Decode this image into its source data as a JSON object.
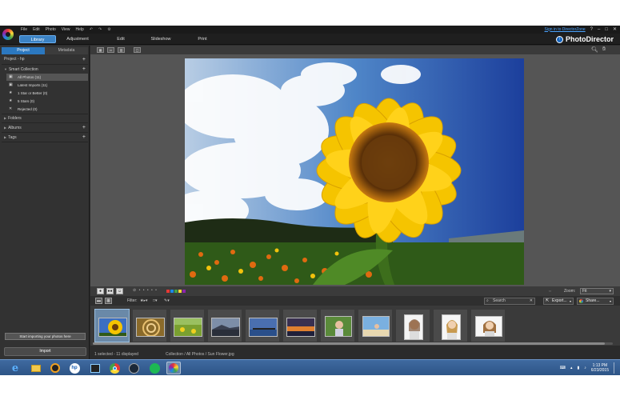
{
  "window": {
    "menu": [
      "File",
      "Edit",
      "Photo",
      "View",
      "Help"
    ],
    "signin_link": "Sign in to DirectorZone",
    "brand": "PhotoDirector"
  },
  "modes": [
    "Library",
    "Adjustment",
    "Edit",
    "Slideshow",
    "Print"
  ],
  "left_panel": {
    "tabs": [
      "Project",
      "Metadata"
    ],
    "project_label": "Project - hp",
    "smart_collection": "Smart Collection",
    "collection_items": [
      {
        "label": "All Photos (11)",
        "icon": "photos-icon"
      },
      {
        "label": "Latest Imports (11)",
        "icon": "import-icon"
      },
      {
        "label": "1 Star or Better (0)",
        "icon": "star-icon"
      },
      {
        "label": "5 Stars (0)",
        "icon": "star-icon"
      },
      {
        "label": "Rejected (0)",
        "icon": "reject-icon"
      }
    ],
    "folders": "Folders",
    "albums": "Albums",
    "tags": "Tags",
    "start_import": "Start importing your photos here",
    "import_button": "Import"
  },
  "viewer": {
    "zoom_label": "Zoom:",
    "zoom_value": "Fit"
  },
  "filmstrip_toolbar": {
    "filter_label": "Filter:",
    "search_placeholder": "Search",
    "export": "Export...",
    "share": "Share..."
  },
  "thumbnails": [
    {
      "name": "Sun Flower",
      "kind": "sunflower",
      "selected": true
    },
    {
      "name": "Spiral",
      "kind": "spiral"
    },
    {
      "name": "Field",
      "kind": "field"
    },
    {
      "name": "Coast",
      "kind": "coast"
    },
    {
      "name": "Pier",
      "kind": "pier"
    },
    {
      "name": "Sunset",
      "kind": "sunset"
    },
    {
      "name": "Child",
      "kind": "child"
    },
    {
      "name": "Beach",
      "kind": "beach"
    },
    {
      "name": "Portrait 1",
      "kind": "portrait1"
    },
    {
      "name": "Portrait 2",
      "kind": "portrait2"
    },
    {
      "name": "Portrait 3",
      "kind": "portrait3"
    }
  ],
  "status": {
    "count": "1 selected - 11 displayed",
    "path": "Collection / All Photos / Sun Flower.jpg"
  },
  "taskbar": {
    "time": "1:13 PM",
    "date": "6/23/2015"
  },
  "colors": {
    "accent": "#2b78c0",
    "panel_bg": "#323232",
    "viewer_bg": "#555555",
    "taskbar": "#2d5486"
  }
}
